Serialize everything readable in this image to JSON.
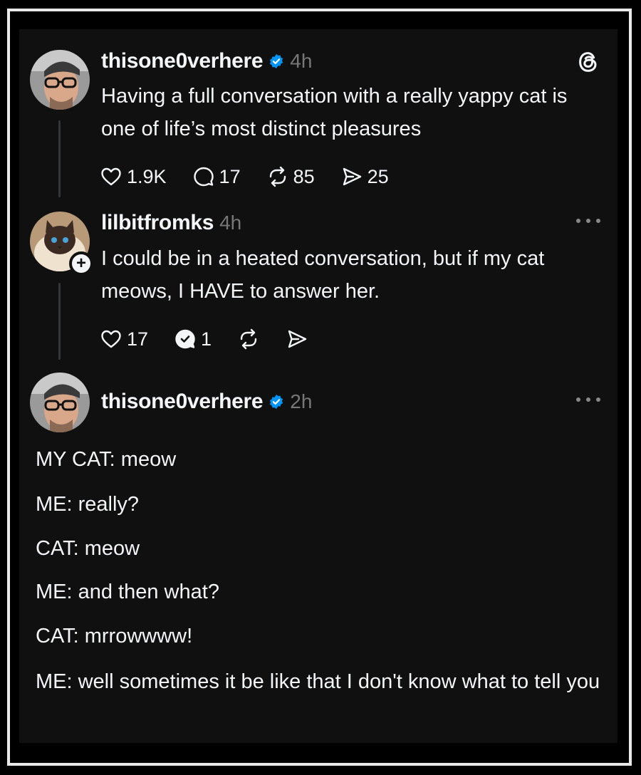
{
  "posts": [
    {
      "username": "thisone0verhere",
      "verified": true,
      "time": "4h",
      "text": "Having a full conversation with a really yappy cat is one of life’s most distinct pleasures",
      "likes": "1.9K",
      "replies": "17",
      "reposts": "85",
      "shares": "25"
    },
    {
      "username": "lilbitfromks",
      "verified": false,
      "time": "4h",
      "text": "I could be in a heated conversation, but if my cat meows, I HAVE to answer her.",
      "likes": "17",
      "replies": "1"
    },
    {
      "username": "thisone0verhere",
      "verified": true,
      "time": "2h",
      "lines": [
        "MY CAT: meow",
        "ME: really?",
        "CAT: meow",
        "ME: and then what?",
        "CAT: mrrowwww!",
        "ME: well sometimes it be like that I don't know what to tell you"
      ]
    }
  ],
  "colors": {
    "background": "#101010",
    "text": "#f3f5f7",
    "muted": "#777777",
    "verified": "#0095f6"
  },
  "icons": {
    "logo": "threads-logo-icon",
    "like": "heart-icon",
    "reply": "comment-icon",
    "repost": "repost-icon",
    "share": "send-icon",
    "more": "more-dots-icon",
    "follow": "plus-icon"
  }
}
